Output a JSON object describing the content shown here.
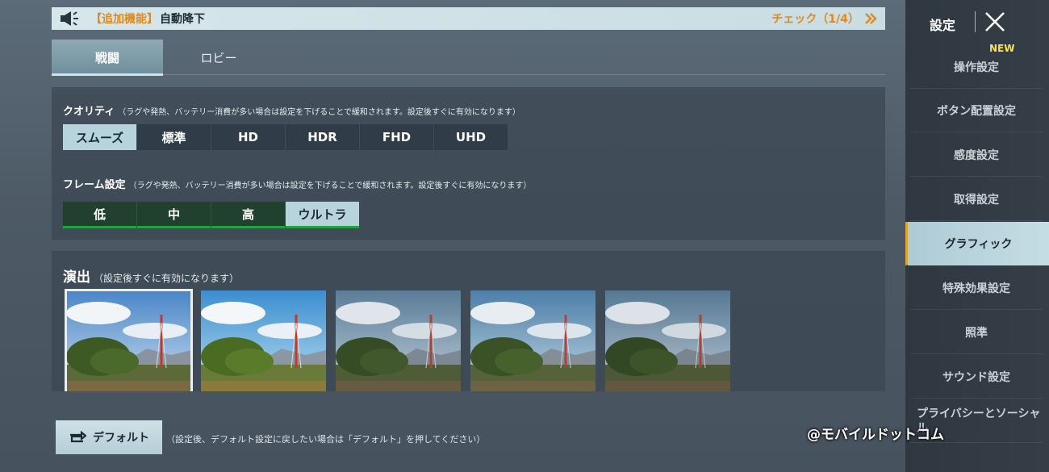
{
  "notice": {
    "tag": "【追加機能】",
    "text": "自動降下",
    "check": "チェック（1/4）"
  },
  "tabs": [
    {
      "label": "戦闘",
      "active": true
    },
    {
      "label": "ロビー",
      "active": false
    }
  ],
  "quality": {
    "title": "クオリティ",
    "note": "（ラグや発熱、バッテリー消費が多い場合は設定を下げることで緩和されます。設定後すぐに有効になります）",
    "options": [
      "スムーズ",
      "標準",
      "HD",
      "HDR",
      "FHD",
      "UHD"
    ],
    "selected": "スムーズ"
  },
  "frame": {
    "title": "フレーム設定",
    "note": "（ラグや発熱、バッテリー消費が多い場合は設定を下げることで緩和されます。設定後すぐに有効になります）",
    "options": [
      "低",
      "中",
      "高",
      "ウルトラ"
    ],
    "selected": "ウルトラ"
  },
  "effects": {
    "title": "演出",
    "note": "（設定後すぐに有効になります）",
    "thumb_count_visible": 5,
    "selected_index": 0
  },
  "default_button": {
    "label": "デフォルト",
    "note": "（設定後、デフォルト設定に戻したい場合は「デフォルト」を押してください）"
  },
  "sidebar": {
    "title": "設定",
    "new_badge": "NEW",
    "items": [
      {
        "label": "操作設定"
      },
      {
        "label": "ボタン配置設定"
      },
      {
        "label": "感度設定"
      },
      {
        "label": "取得設定"
      },
      {
        "label": "グラフィック",
        "active": true
      },
      {
        "label": "特殊効果設定"
      },
      {
        "label": "照準"
      },
      {
        "label": "サウンド設定"
      },
      {
        "label": "プライバシーとソーシャル"
      }
    ]
  },
  "watermark": "@モバイルドットコム",
  "colors": {
    "accent_orange": "#e08a1e",
    "selected_bg": "#b7d3dc",
    "frame_green": "#27a045",
    "new_yellow": "#ffe14a"
  }
}
